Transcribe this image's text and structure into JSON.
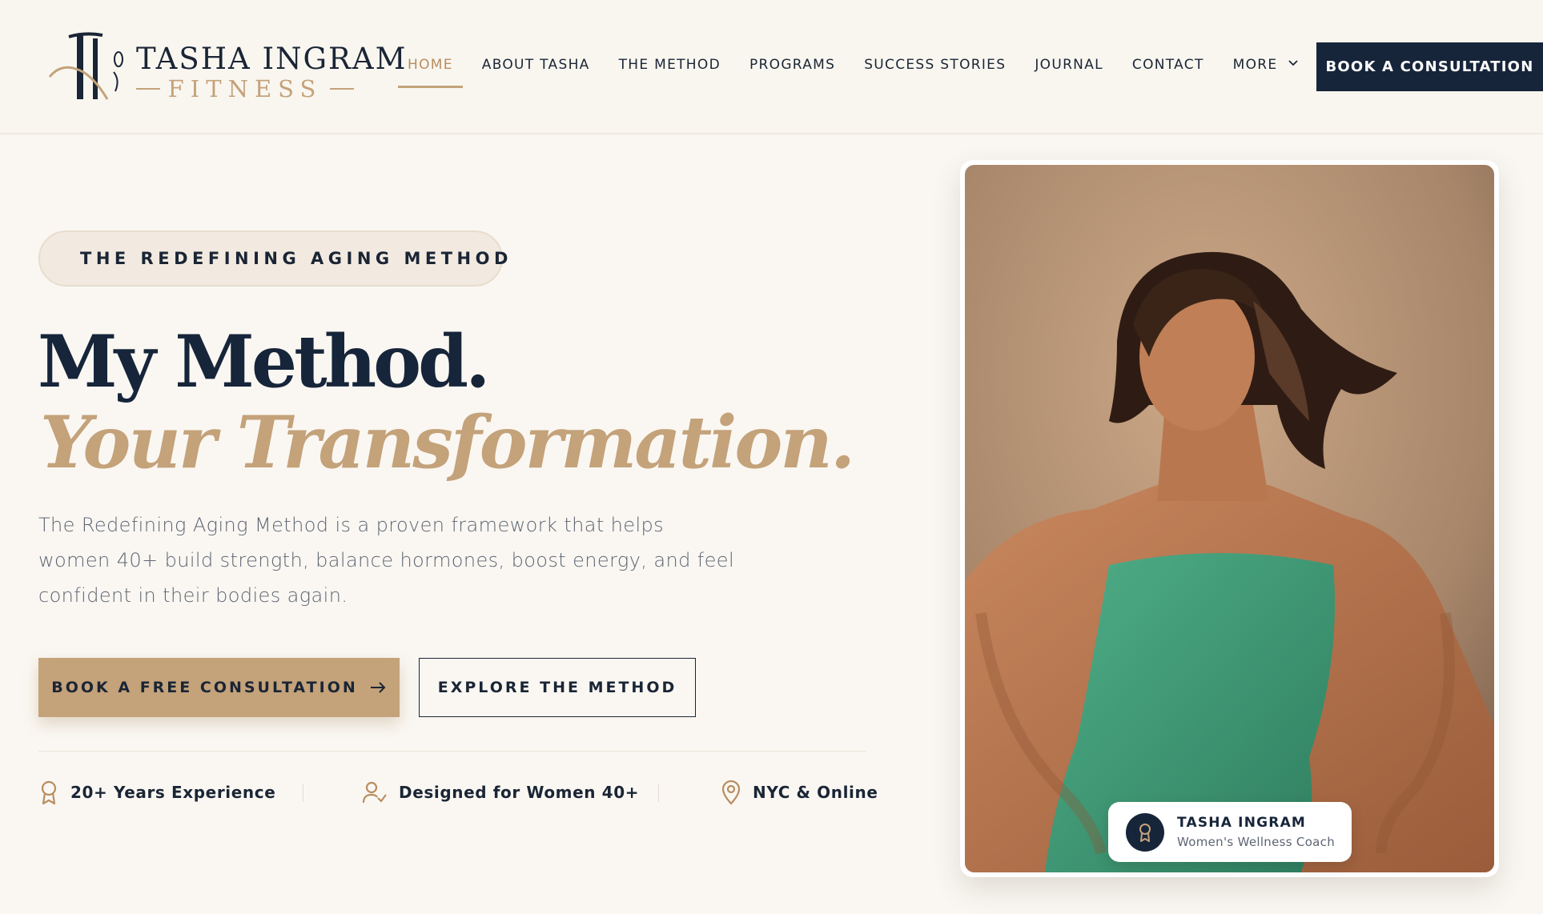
{
  "brand": {
    "monogram": "TI",
    "name": "TASHA INGRAM",
    "sub": "FITNESS"
  },
  "nav": {
    "items": [
      {
        "label": "HOME",
        "active": true
      },
      {
        "label": "ABOUT TASHA",
        "active": false
      },
      {
        "label": "THE METHOD",
        "active": false
      },
      {
        "label": "PROGRAMS",
        "active": false
      },
      {
        "label": "SUCCESS STORIES",
        "active": false
      },
      {
        "label": "JOURNAL",
        "active": false
      },
      {
        "label": "CONTACT",
        "active": false
      },
      {
        "label": "MORE",
        "active": false,
        "icon": "chevron-down-icon"
      }
    ],
    "cta_label": "BOOK A CONSULTATION"
  },
  "hero": {
    "eyebrow": "THE REDEFINING AGING METHOD",
    "title_line1": "My Method.",
    "title_line2": "Your Transformation.",
    "description": "The Redefining Aging Method is a proven framework that helps women 40+ build strength, balance hormones, boost energy, and feel confident in their bodies again.",
    "primary_cta": "BOOK A FREE CONSULTATION",
    "secondary_cta": "EXPLORE THE METHOD",
    "features": [
      {
        "icon": "award-icon",
        "label": "20+ Years Experience"
      },
      {
        "icon": "user-check-icon",
        "label": "Designed for Women 40+"
      },
      {
        "icon": "map-pin-icon",
        "label": "NYC & Online"
      }
    ]
  },
  "profile_badge": {
    "icon": "award-icon",
    "name": "TASHA INGRAM",
    "role": "Women's Wellness Coach"
  },
  "colors": {
    "navy": "#17253a",
    "gold": "#c4a27a",
    "background": "#faf7f2",
    "dress": "#3e9a78"
  }
}
